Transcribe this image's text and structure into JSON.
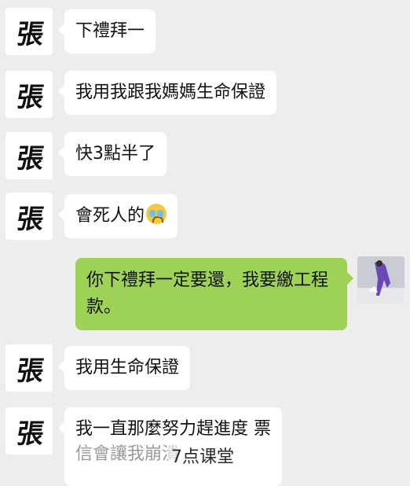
{
  "chat": {
    "sender_glyph": "張",
    "messages": [
      {
        "side": "left",
        "text": "下禮拜一"
      },
      {
        "side": "left",
        "text": "我用我跟我媽媽生命保證"
      },
      {
        "side": "left",
        "text": "快3點半了"
      },
      {
        "side": "left",
        "text": "會死人的",
        "emoji": "crying-face-icon"
      },
      {
        "side": "right",
        "text": "你下禮拜一定要還，我要繳工程款。"
      },
      {
        "side": "left",
        "text": "我用生命保證"
      },
      {
        "side": "left",
        "text": "我一直那麼努力趕進度 票",
        "text2": "信會讓我崩潰"
      }
    ]
  },
  "watermark": "7点课堂",
  "colors": {
    "background": "#ededed",
    "incoming_bubble": "#ffffff",
    "outgoing_bubble": "#9ed256"
  }
}
